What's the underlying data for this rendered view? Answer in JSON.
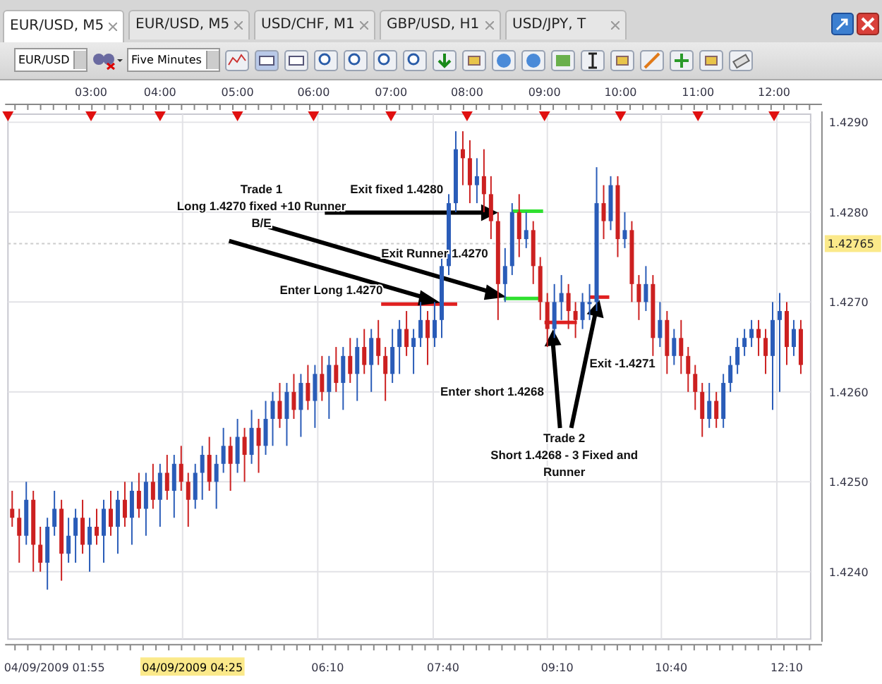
{
  "tabs": [
    {
      "label": "EUR/USD, M5",
      "selected": true
    },
    {
      "label": "EUR/USD, M5",
      "selected": false
    },
    {
      "label": "USD/CHF, M1",
      "selected": false
    },
    {
      "label": "GBP/USD, H1",
      "selected": false
    },
    {
      "label": "USD/JPY, T",
      "selected": false
    }
  ],
  "toolbar": {
    "symbol": "EUR/USD",
    "timeframe": "Five Minutes"
  },
  "chart": {
    "top_axis": [
      "03:00",
      "04:00",
      "05:00",
      "06:00",
      "07:00",
      "08:00",
      "09:00",
      "10:00",
      "11:00",
      "12:00"
    ],
    "chart_data": {
      "type": "candlestick",
      "ylim": [
        1.42325,
        1.42909
      ],
      "grid": true,
      "ref_lines": [
        {
          "axis": "y",
          "value": 1.42765,
          "label": "1.42765"
        }
      ],
      "yticks": [
        {
          "value": 1.429,
          "label": "1.4290"
        },
        {
          "value": 1.428,
          "label": "1.4280"
        },
        {
          "value": 1.427,
          "label": "1.4270"
        },
        {
          "value": 1.426,
          "label": "1.4260"
        },
        {
          "value": 1.425,
          "label": "1.4250"
        },
        {
          "value": 1.424,
          "label": "1.4240"
        }
      ],
      "ohlc": [
        [
          1.4247,
          1.4249,
          1.4245,
          1.4246
        ],
        [
          1.4246,
          1.4247,
          1.4241,
          1.4244
        ],
        [
          1.4244,
          1.425,
          1.4243,
          1.4248
        ],
        [
          1.4248,
          1.4249,
          1.424,
          1.4243
        ],
        [
          1.4243,
          1.4245,
          1.424,
          1.4241
        ],
        [
          1.4241,
          1.4246,
          1.4238,
          1.4245
        ],
        [
          1.4245,
          1.4249,
          1.4244,
          1.4247
        ],
        [
          1.4247,
          1.4248,
          1.4239,
          1.4242
        ],
        [
          1.4242,
          1.4246,
          1.4241,
          1.4244
        ],
        [
          1.4244,
          1.4247,
          1.4241,
          1.4246
        ],
        [
          1.4246,
          1.4248,
          1.4242,
          1.4243
        ],
        [
          1.4243,
          1.4246,
          1.424,
          1.4245
        ],
        [
          1.4245,
          1.4247,
          1.4243,
          1.4244
        ],
        [
          1.4244,
          1.4248,
          1.4241,
          1.4247
        ],
        [
          1.4247,
          1.4249,
          1.4244,
          1.4245
        ],
        [
          1.4245,
          1.4249,
          1.4242,
          1.4248
        ],
        [
          1.4248,
          1.425,
          1.4245,
          1.4246
        ],
        [
          1.4246,
          1.425,
          1.4243,
          1.4249
        ],
        [
          1.4249,
          1.4251,
          1.4246,
          1.4247
        ],
        [
          1.4247,
          1.4251,
          1.4244,
          1.425
        ],
        [
          1.425,
          1.4252,
          1.4247,
          1.4248
        ],
        [
          1.4248,
          1.4252,
          1.4245,
          1.4251
        ],
        [
          1.4251,
          1.4253,
          1.4248,
          1.4249
        ],
        [
          1.4249,
          1.4253,
          1.4246,
          1.4252
        ],
        [
          1.4252,
          1.4254,
          1.4249,
          1.425
        ],
        [
          1.425,
          1.4251,
          1.4245,
          1.4248
        ],
        [
          1.4248,
          1.4252,
          1.4247,
          1.4251
        ],
        [
          1.4251,
          1.4254,
          1.4248,
          1.4253
        ],
        [
          1.4253,
          1.4255,
          1.4249,
          1.425
        ],
        [
          1.425,
          1.4253,
          1.4247,
          1.4252
        ],
        [
          1.4252,
          1.4256,
          1.4251,
          1.4254
        ],
        [
          1.4254,
          1.4255,
          1.4249,
          1.4252
        ],
        [
          1.4252,
          1.4257,
          1.4251,
          1.4255
        ],
        [
          1.4255,
          1.4256,
          1.425,
          1.4253
        ],
        [
          1.4253,
          1.4258,
          1.4252,
          1.4256
        ],
        [
          1.4256,
          1.4257,
          1.4251,
          1.4254
        ],
        [
          1.4254,
          1.4259,
          1.4253,
          1.4257
        ],
        [
          1.4257,
          1.426,
          1.4254,
          1.4259
        ],
        [
          1.4259,
          1.4261,
          1.4256,
          1.4257
        ],
        [
          1.4257,
          1.4261,
          1.4254,
          1.426
        ],
        [
          1.426,
          1.4262,
          1.4257,
          1.4258
        ],
        [
          1.4258,
          1.4262,
          1.4255,
          1.4261
        ],
        [
          1.4261,
          1.4263,
          1.4258,
          1.4259
        ],
        [
          1.4259,
          1.4263,
          1.4256,
          1.4262
        ],
        [
          1.4262,
          1.4264,
          1.4259,
          1.426
        ],
        [
          1.426,
          1.4264,
          1.4257,
          1.4263
        ],
        [
          1.4263,
          1.4265,
          1.426,
          1.4261
        ],
        [
          1.4261,
          1.4265,
          1.4258,
          1.4264
        ],
        [
          1.4264,
          1.4266,
          1.4261,
          1.4262
        ],
        [
          1.4262,
          1.4266,
          1.4259,
          1.4265
        ],
        [
          1.4265,
          1.4267,
          1.4262,
          1.4263
        ],
        [
          1.4263,
          1.4267,
          1.426,
          1.4266
        ],
        [
          1.4266,
          1.4268,
          1.4263,
          1.4264
        ],
        [
          1.4264,
          1.4265,
          1.4259,
          1.4262
        ],
        [
          1.4262,
          1.4267,
          1.4261,
          1.4265
        ],
        [
          1.4265,
          1.4268,
          1.4262,
          1.4267
        ],
        [
          1.4267,
          1.4269,
          1.4264,
          1.4265
        ],
        [
          1.4265,
          1.4267,
          1.4262,
          1.4266
        ],
        [
          1.4266,
          1.427,
          1.4265,
          1.4268
        ],
        [
          1.4268,
          1.4269,
          1.4263,
          1.4266
        ],
        [
          1.4266,
          1.427,
          1.4265,
          1.4268
        ],
        [
          1.4268,
          1.4275,
          1.4266,
          1.4274
        ],
        [
          1.4274,
          1.4282,
          1.4273,
          1.4281
        ],
        [
          1.4281,
          1.4289,
          1.428,
          1.4287
        ],
        [
          1.4287,
          1.4289,
          1.4283,
          1.4286
        ],
        [
          1.4286,
          1.4288,
          1.4281,
          1.4283
        ],
        [
          1.4283,
          1.4286,
          1.4281,
          1.4284
        ],
        [
          1.4284,
          1.4287,
          1.428,
          1.4282
        ],
        [
          1.4282,
          1.4284,
          1.4277,
          1.4279
        ],
        [
          1.4279,
          1.428,
          1.4268,
          1.4272
        ],
        [
          1.4272,
          1.4276,
          1.427,
          1.4274
        ],
        [
          1.4274,
          1.4281,
          1.4273,
          1.428
        ],
        [
          1.428,
          1.4282,
          1.4275,
          1.4277
        ],
        [
          1.4277,
          1.428,
          1.4276,
          1.4278
        ],
        [
          1.4278,
          1.4279,
          1.4272,
          1.4274
        ],
        [
          1.4274,
          1.4275,
          1.4268,
          1.427
        ],
        [
          1.427,
          1.4271,
          1.4265,
          1.4267
        ],
        [
          1.4267,
          1.4272,
          1.4266,
          1.427
        ],
        [
          1.427,
          1.4273,
          1.4268,
          1.4271
        ],
        [
          1.4271,
          1.4272,
          1.4267,
          1.4269
        ],
        [
          1.4269,
          1.427,
          1.4266,
          1.4268
        ],
        [
          1.4268,
          1.4271,
          1.4267,
          1.427
        ],
        [
          1.427,
          1.4272,
          1.4268,
          1.427
        ],
        [
          1.427,
          1.4285,
          1.4269,
          1.4281
        ],
        [
          1.4281,
          1.4283,
          1.4277,
          1.4279
        ],
        [
          1.4279,
          1.4284,
          1.4278,
          1.4283
        ],
        [
          1.4283,
          1.4284,
          1.4275,
          1.4277
        ],
        [
          1.4277,
          1.428,
          1.4276,
          1.4278
        ],
        [
          1.4278,
          1.4279,
          1.427,
          1.4272
        ],
        [
          1.4272,
          1.4273,
          1.4268,
          1.427
        ],
        [
          1.427,
          1.4274,
          1.4269,
          1.4272
        ],
        [
          1.4272,
          1.4273,
          1.4264,
          1.4266
        ],
        [
          1.4266,
          1.427,
          1.4265,
          1.4268
        ],
        [
          1.4268,
          1.4269,
          1.4262,
          1.4264
        ],
        [
          1.4264,
          1.4267,
          1.4263,
          1.4266
        ],
        [
          1.4266,
          1.4268,
          1.4262,
          1.4264
        ],
        [
          1.4264,
          1.4265,
          1.426,
          1.4262
        ],
        [
          1.4262,
          1.4263,
          1.4258,
          1.426
        ],
        [
          1.426,
          1.4261,
          1.4255,
          1.4257
        ],
        [
          1.4257,
          1.4261,
          1.4256,
          1.4259
        ],
        [
          1.4259,
          1.426,
          1.4256,
          1.4257
        ],
        [
          1.4257,
          1.4262,
          1.4256,
          1.4261
        ],
        [
          1.4261,
          1.4264,
          1.426,
          1.4263
        ],
        [
          1.4263,
          1.4266,
          1.4262,
          1.4265
        ],
        [
          1.4265,
          1.4267,
          1.4264,
          1.4266
        ],
        [
          1.4266,
          1.4268,
          1.4265,
          1.4267
        ],
        [
          1.4267,
          1.4268,
          1.4264,
          1.4266
        ],
        [
          1.4266,
          1.4267,
          1.4262,
          1.4264
        ],
        [
          1.4264,
          1.427,
          1.4258,
          1.4268
        ],
        [
          1.4268,
          1.4271,
          1.426,
          1.4269
        ],
        [
          1.4269,
          1.427,
          1.4263,
          1.4265
        ],
        [
          1.4265,
          1.4268,
          1.4264,
          1.4267
        ],
        [
          1.4267,
          1.4268,
          1.4262,
          1.4263
        ]
      ]
    },
    "bottom_axis": [
      {
        "label": "04/09/2009 01:55",
        "highlighted": false
      },
      {
        "label": "04/09/2009 04:25",
        "highlighted": true
      },
      {
        "label": "06:10",
        "highlighted": false
      },
      {
        "label": "07:40",
        "highlighted": false
      },
      {
        "label": "09:10",
        "highlighted": false
      },
      {
        "label": "10:40",
        "highlighted": false
      },
      {
        "label": "12:10",
        "highlighted": false
      }
    ],
    "annotations": [
      {
        "lines": [
          "Trade 1",
          "Long 1.4270 fixed +10 Runner",
          "B/E"
        ]
      },
      {
        "lines": [
          "Exit fixed 1.4280"
        ]
      },
      {
        "lines": [
          "Exit Runner 1.4270"
        ]
      },
      {
        "lines": [
          "Enter Long 1.4270"
        ]
      },
      {
        "lines": [
          "Enter short 1.4268"
        ]
      },
      {
        "lines": [
          "Exit -1.4271"
        ]
      },
      {
        "lines": [
          "Trade 2",
          "Short 1.4268 - 3 Fixed and",
          "Runner"
        ]
      }
    ]
  }
}
